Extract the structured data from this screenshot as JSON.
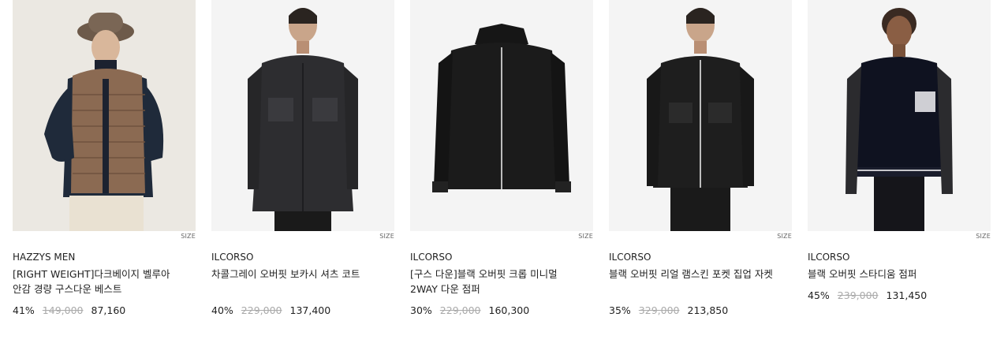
{
  "size_label": "SIZE",
  "products": [
    {
      "brand": "HAZZYS MEN",
      "name": "[RIGHT WEIGHT]다크베이지 벨루아 안감 경량 구스다운 베스트",
      "discount": "41%",
      "original_price": "149,000",
      "sale_price": "87,160",
      "image_icon": "model-wearing-puffer-vest"
    },
    {
      "brand": "ILCORSO",
      "name": "차콜그레이 오버핏 보카시 셔츠 코트",
      "discount": "40%",
      "original_price": "229,000",
      "sale_price": "137,400",
      "image_icon": "model-wearing-shirt-coat"
    },
    {
      "brand": "ILCORSO",
      "name": "[구스 다운]블랙 오버핏 크롭 미니멀 2WAY 다운 점퍼",
      "discount": "30%",
      "original_price": "229,000",
      "sale_price": "160,300",
      "image_icon": "black-down-jacket"
    },
    {
      "brand": "ILCORSO",
      "name": "블랙 오버핏 리얼 램스킨 포켓 집업 자켓",
      "discount": "35%",
      "original_price": "329,000",
      "sale_price": "213,850",
      "image_icon": "model-wearing-leather-jacket"
    },
    {
      "brand": "ILCORSO",
      "name": "블랙 오버핏 스타디움 점퍼",
      "discount": "45%",
      "original_price": "239,000",
      "sale_price": "131,450",
      "image_icon": "model-wearing-stadium-jumper"
    }
  ]
}
